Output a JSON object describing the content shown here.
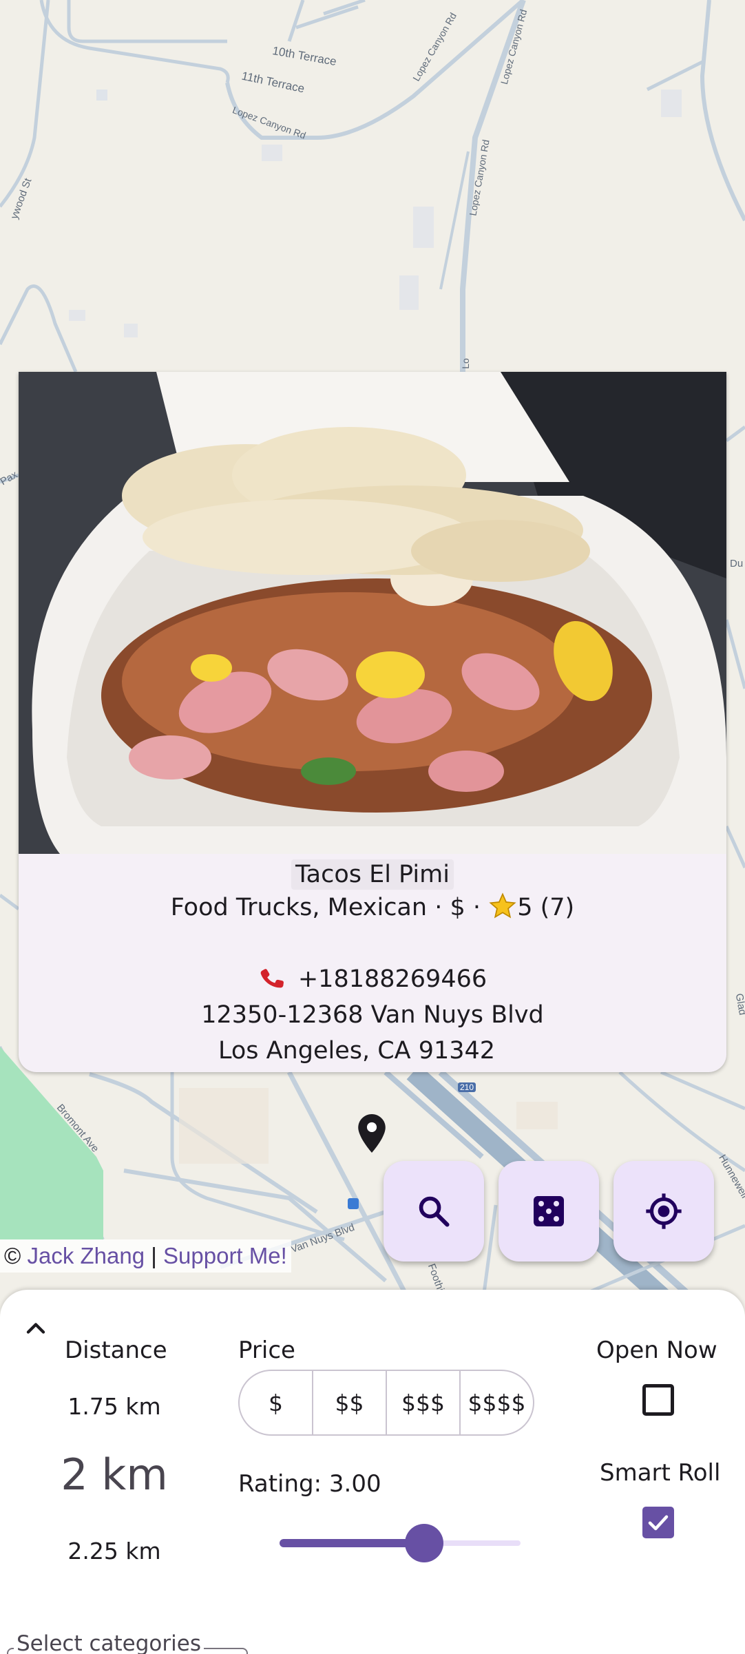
{
  "map": {
    "street_labels": [
      "10th Terrace",
      "11th Terrace",
      "Lopez Canyon Rd",
      "Lopez Canyon Rd",
      "Lopez Canyon Rd",
      "Lopez Canyon Rd",
      "Lo",
      "Bromont Ave",
      "Hunnewell",
      "Foothill",
      "Van Nuys Blvd",
      "Glad",
      "Pax",
      "Du",
      "ywood St",
      "210"
    ],
    "pin_icon": "location-pin-icon"
  },
  "place": {
    "name": "Tacos El Pimi",
    "categories": "Food Trucks, Mexican",
    "separator": "·",
    "price": "$",
    "rating": "5",
    "review_count": "(7)",
    "phone": "+18188269466",
    "address_line1": "12350-12368 Van Nuys Blvd",
    "address_line2": "Los Angeles, CA 91342"
  },
  "fabs": {
    "search_icon": "search-icon",
    "random_icon": "dice-icon",
    "locate_icon": "my-location-icon"
  },
  "attribution": {
    "copyright": "©",
    "author": "Jack Zhang",
    "divider": "|",
    "support": "Support Me!"
  },
  "filters": {
    "distance": {
      "title": "Distance",
      "prev": "1.75 km",
      "selected": "2 km",
      "next": "2.25 km"
    },
    "price": {
      "title": "Price",
      "options": [
        "$",
        "$$",
        "$$$",
        "$$$$"
      ]
    },
    "rating": {
      "label": "Rating: 3.00",
      "value": 3.0,
      "min": 0,
      "max": 5
    },
    "open_now": {
      "title": "Open Now",
      "checked": false
    },
    "smart_roll": {
      "title": "Smart Roll",
      "checked": true
    },
    "categories": {
      "label": "Select categories"
    }
  },
  "colors": {
    "primary": "#6750a4",
    "fab_bg": "#ece2fa",
    "card_bg": "#f5f0f7",
    "park": "#a6e3bd",
    "highway": "#9fb4c8"
  }
}
